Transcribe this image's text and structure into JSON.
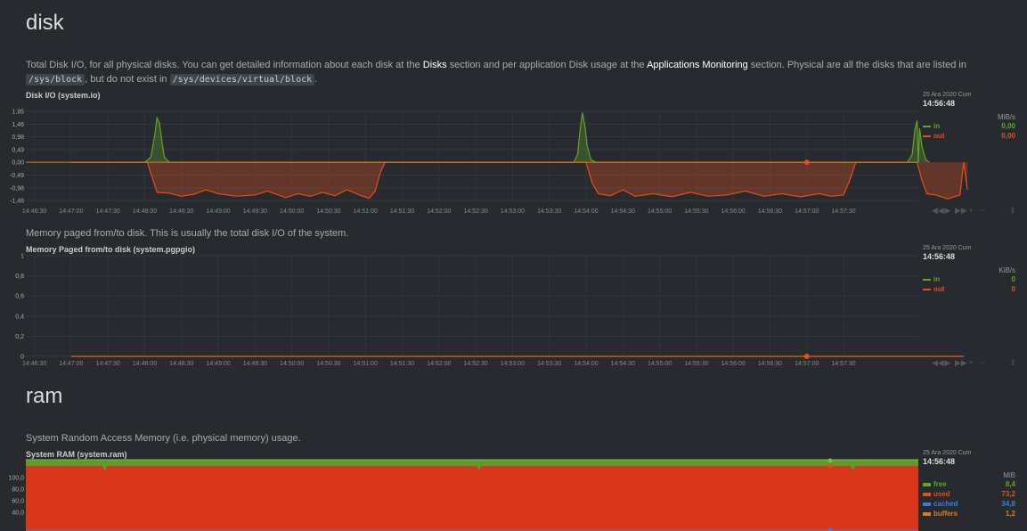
{
  "disk": {
    "title": "disk",
    "description": {
      "part1": "Total Disk I/O, for all physical disks. You can get detailed information about each disk at the ",
      "link1": "Disks",
      "part2": " section and per application Disk usage at the ",
      "link2": "Applications Monitoring",
      "part3": " section. Physical are all the disks that are listed in ",
      "code1": "/sys/block",
      "part4": ", but do not exist in ",
      "code2": "/sys/devices/virtual/block",
      "part5": "."
    }
  },
  "pgpgio_description": "Memory paged from/to disk. This is usually the total disk I/O of the system.",
  "ram": {
    "title": "ram",
    "description": "System Random Access Memory (i.e. physical memory) usage."
  },
  "legend_common": {
    "date": "25 Ara 2020 Cum",
    "time": "14:56:48"
  },
  "toolbar": {
    "back": "◀◀",
    "play": "▶",
    "forward": "▶▶",
    "zoom_in": "+",
    "zoom_out": "−",
    "resize": "⇕"
  },
  "x_ticks": [
    "14:46:30",
    "14:47:00",
    "14:47:30",
    "14:48:00",
    "14:48:30",
    "14:49:00",
    "14:49:30",
    "14:50:00",
    "14:50:30",
    "14:51:00",
    "14:51:30",
    "14:52:00",
    "14:52:30",
    "14:53:00",
    "14:53:30",
    "14:54:00",
    "14:54:30",
    "14:55:00",
    "14:55:30",
    "14:56:00",
    "14:56:30",
    "14:57:00",
    "14:57:30"
  ],
  "chart_data": [
    {
      "id": "system.io",
      "type": "area",
      "title": "Disk I/O (system.io)",
      "units": "MiB/s",
      "ylim": [
        -1.46,
        1.95
      ],
      "y_ticks": [
        "1,95",
        "1,46",
        "0,98",
        "0,49",
        "0,00",
        "-0,49",
        "-0,98",
        "-1,46"
      ],
      "y_tick_values": [
        1.95,
        1.46,
        0.98,
        0.49,
        0,
        -0.49,
        -0.98,
        -1.46
      ],
      "x_range_seconds": [
        -37,
        691
      ],
      "series": [
        {
          "name": "in",
          "display_value": "0,00",
          "color": "#61a32b",
          "points": [
            [
              0,
              0
            ],
            [
              60,
              0
            ],
            [
              65,
              0.2
            ],
            [
              68,
              1.0
            ],
            [
              70,
              1.7
            ],
            [
              72,
              1.5
            ],
            [
              74,
              0.8
            ],
            [
              76,
              0.2
            ],
            [
              80,
              0
            ],
            [
              410,
              0
            ],
            [
              413,
              0.3
            ],
            [
              415,
              1.2
            ],
            [
              417,
              1.9
            ],
            [
              419,
              1.4
            ],
            [
              421,
              0.6
            ],
            [
              424,
              0.1
            ],
            [
              428,
              0
            ],
            [
              682,
              0
            ],
            [
              686,
              0.3
            ],
            [
              688,
              1.2
            ],
            [
              690,
              1.6
            ],
            [
              692,
              1.3
            ],
            [
              694,
              0.6
            ],
            [
              697,
              0.1
            ],
            [
              700,
              0
            ],
            [
              691,
              0
            ]
          ]
        },
        {
          "name": "out",
          "display_value": "0,00",
          "color": "#e44d1f",
          "points": [
            [
              0,
              0
            ],
            [
              62,
              0
            ],
            [
              67,
              -0.7
            ],
            [
              70,
              -1.15
            ],
            [
              80,
              -1.18
            ],
            [
              90,
              -1.3
            ],
            [
              100,
              -1.22
            ],
            [
              110,
              -1.05
            ],
            [
              120,
              -1.2
            ],
            [
              135,
              -1.3
            ],
            [
              150,
              -1.25
            ],
            [
              160,
              -1.1
            ],
            [
              175,
              -1.35
            ],
            [
              185,
              -1.2
            ],
            [
              195,
              -1.3
            ],
            [
              205,
              -1.15
            ],
            [
              215,
              -1.28
            ],
            [
              225,
              -1.05
            ],
            [
              235,
              -1.25
            ],
            [
              243,
              -1.38
            ],
            [
              248,
              -1.1
            ],
            [
              252,
              -0.4
            ],
            [
              256,
              0
            ],
            [
              420,
              0
            ],
            [
              425,
              -0.8
            ],
            [
              430,
              -1.2
            ],
            [
              440,
              -1.28
            ],
            [
              450,
              -1.05
            ],
            [
              460,
              -1.3
            ],
            [
              475,
              -1.2
            ],
            [
              490,
              -1.32
            ],
            [
              505,
              -1.15
            ],
            [
              520,
              -1.3
            ],
            [
              535,
              -1.25
            ],
            [
              550,
              -1.1
            ],
            [
              565,
              -1.3
            ],
            [
              580,
              -1.2
            ],
            [
              595,
              -1.32
            ],
            [
              610,
              -1.2
            ],
            [
              620,
              -1.3
            ],
            [
              630,
              -1.25
            ],
            [
              635,
              -0.7
            ],
            [
              640,
              0
            ],
            [
              690,
              0
            ],
            [
              694,
              -0.7
            ],
            [
              698,
              -1.2
            ],
            [
              705,
              -1.25
            ],
            [
              715,
              -1.4
            ],
            [
              725,
              -1.25
            ],
            [
              731,
              -1.05
            ],
            [
              728,
              0
            ]
          ]
        }
      ]
    },
    {
      "id": "system.pgpgio",
      "type": "area",
      "title": "Memory Paged from/to disk (system.pgpgio)",
      "units": "KiB/s",
      "ylim": [
        0,
        1
      ],
      "y_ticks": [
        "1",
        "0,8",
        "0,6",
        "0,4",
        "0,2",
        "0"
      ],
      "y_tick_values": [
        1,
        0.8,
        0.6,
        0.4,
        0.2,
        0
      ],
      "series": [
        {
          "name": "in",
          "display_value": "0",
          "color": "#61a32b",
          "points": [
            [
              0,
              0
            ],
            [
              728,
              0
            ]
          ]
        },
        {
          "name": "out",
          "display_value": "0",
          "color": "#e44d1f",
          "points": [
            [
              0,
              0
            ],
            [
              728,
              0
            ]
          ]
        }
      ]
    },
    {
      "id": "system.ram",
      "type": "area",
      "title": "System RAM (system.ram)",
      "units": "MiB",
      "y_ticks": [
        "100,0",
        "80,0",
        "60,0",
        "40,0"
      ],
      "y_tick_values": [
        100,
        80,
        60,
        40
      ],
      "series": [
        {
          "name": "free",
          "display_value": "8,4",
          "color": "#61a32b"
        },
        {
          "name": "used",
          "display_value": "73,2",
          "color": "#e44d1f"
        },
        {
          "name": "cached",
          "display_value": "34,8",
          "color": "#3b7ddd"
        },
        {
          "name": "buffers",
          "display_value": "1,2",
          "color": "#e07b1a"
        }
      ]
    }
  ]
}
